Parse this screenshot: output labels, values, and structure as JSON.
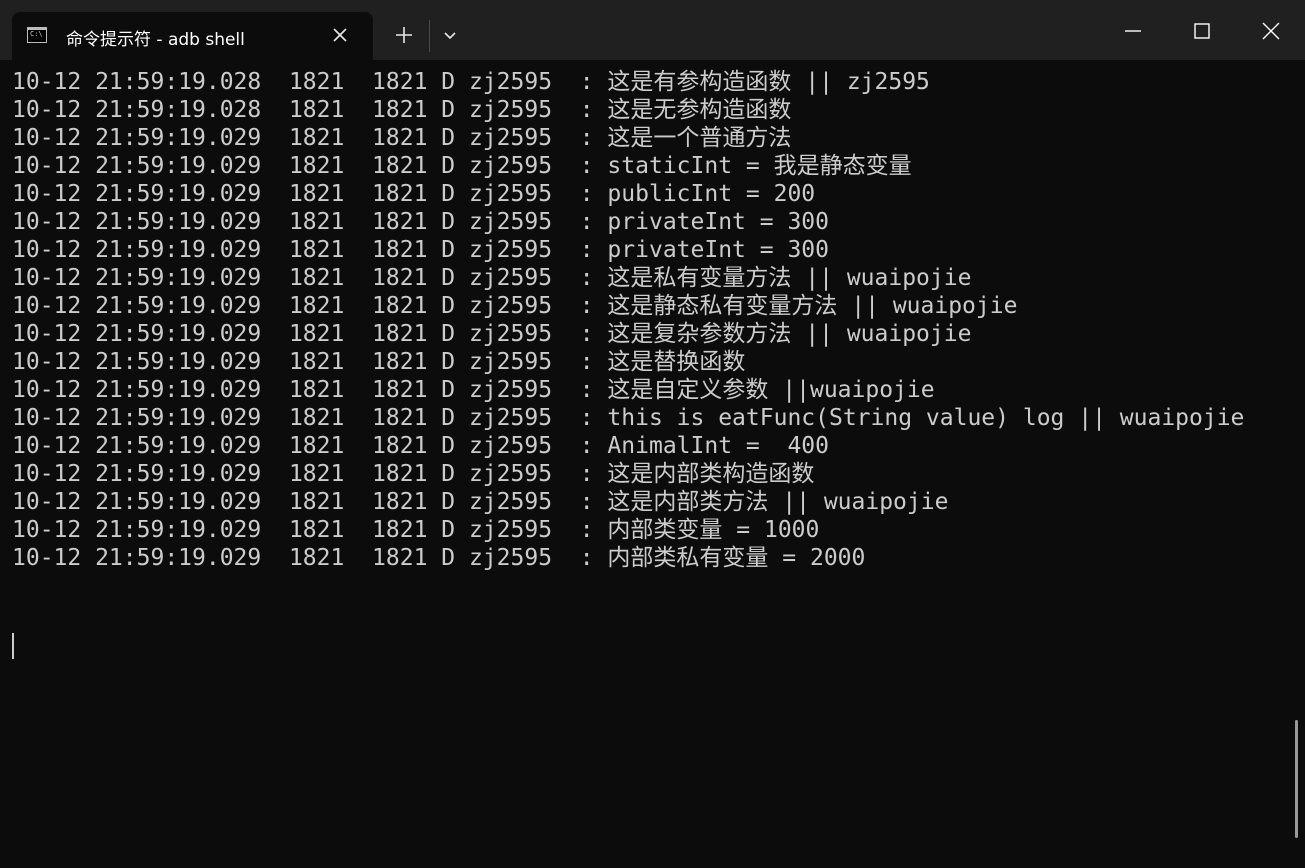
{
  "window": {
    "tab_title": "命令提示符 - adb  shell",
    "tab_icon": "cmd-icon",
    "new_tab_icon": "plus-icon",
    "dropdown_icon": "chevron-down-icon",
    "minimize_icon": "minimize-icon",
    "maximize_icon": "maximize-icon",
    "close_icon": "close-icon"
  },
  "colors": {
    "background": "#0c0c0c",
    "titlebar": "#202020",
    "text": "#cccccc"
  },
  "console": {
    "lines": [
      "10-12 21:59:19.028  1821  1821 D zj2595  : 这是有参构造函数 || zj2595",
      "10-12 21:59:19.028  1821  1821 D zj2595  : 这是无参构造函数",
      "10-12 21:59:19.029  1821  1821 D zj2595  : 这是一个普通方法",
      "10-12 21:59:19.029  1821  1821 D zj2595  : staticInt = 我是静态变量",
      "10-12 21:59:19.029  1821  1821 D zj2595  : publicInt = 200",
      "10-12 21:59:19.029  1821  1821 D zj2595  : privateInt = 300",
      "10-12 21:59:19.029  1821  1821 D zj2595  : privateInt = 300",
      "10-12 21:59:19.029  1821  1821 D zj2595  : 这是私有变量方法 || wuaipojie",
      "10-12 21:59:19.029  1821  1821 D zj2595  : 这是静态私有变量方法 || wuaipojie",
      "10-12 21:59:19.029  1821  1821 D zj2595  : 这是复杂参数方法 || wuaipojie",
      "10-12 21:59:19.029  1821  1821 D zj2595  : 这是替换函数",
      "10-12 21:59:19.029  1821  1821 D zj2595  : 这是自定义参数 ||wuaipojie",
      "10-12 21:59:19.029  1821  1821 D zj2595  : this is eatFunc(String value) log || wuaipojie",
      "10-12 21:59:19.029  1821  1821 D zj2595  : AnimalInt =  400",
      "10-12 21:59:19.029  1821  1821 D zj2595  : 这是内部类构造函数",
      "10-12 21:59:19.029  1821  1821 D zj2595  : 这是内部类方法 || wuaipojie",
      "10-12 21:59:19.029  1821  1821 D zj2595  : 内部类变量 = 1000",
      "10-12 21:59:19.029  1821  1821 D zj2595  : 内部类私有变量 = 2000"
    ]
  }
}
